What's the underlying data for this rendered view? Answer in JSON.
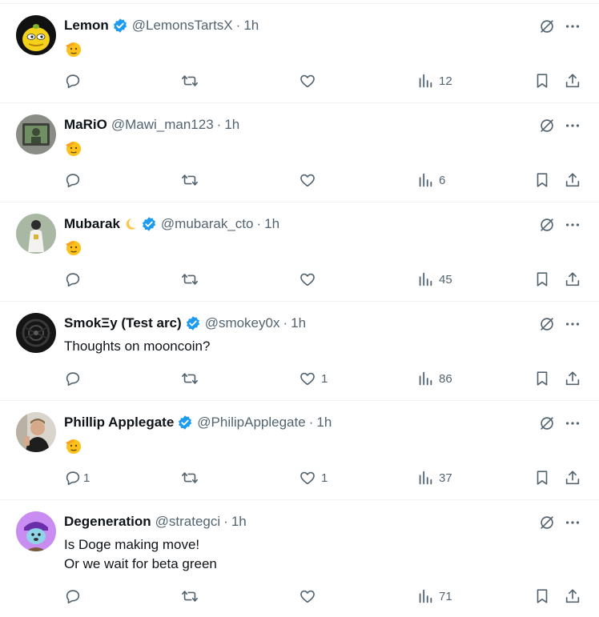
{
  "colors": {
    "text": "#0f1419",
    "muted": "#536471",
    "verified": "#1d9bf0",
    "divider": "#eff3f4"
  },
  "separator": "·",
  "tweets": [
    {
      "display_name": "Lemon",
      "verified": true,
      "handle": "@LemonsTartsX",
      "time": "1h",
      "text_lines": [],
      "emoji": "saluting-face",
      "replies": "",
      "likes": "",
      "views": "12",
      "avatar": "lemon-pepe"
    },
    {
      "display_name": "MaRiO",
      "verified": false,
      "handle": "@Mawi_man123",
      "time": "1h",
      "text_lines": [],
      "emoji": "saluting-face",
      "replies": "",
      "likes": "",
      "views": "6",
      "avatar": "monitor-portrait"
    },
    {
      "display_name": "Mubarak",
      "name_emoji": "crescent-moon",
      "verified": true,
      "handle": "@mubarak_cto",
      "time": "1h",
      "text_lines": [],
      "emoji": "saluting-face",
      "replies": "",
      "likes": "",
      "views": "45",
      "avatar": "white-robe-figure"
    },
    {
      "display_name": "SmokΞy (Test arc)",
      "verified": true,
      "handle": "@smokey0x",
      "time": "1h",
      "text_lines": [
        "Thoughts on mooncoin?"
      ],
      "emoji": "",
      "replies": "",
      "likes": "1",
      "views": "86",
      "avatar": "dark-pattern"
    },
    {
      "display_name": "Phillip Applegate",
      "verified": true,
      "handle": "@PhilipApplegate",
      "time": "1h",
      "text_lines": [],
      "emoji": "saluting-face",
      "replies": "1",
      "likes": "1",
      "views": "37",
      "avatar": "selfie-photo"
    },
    {
      "display_name": "Degeneration",
      "verified": false,
      "handle": "@strategci",
      "time": "1h",
      "text_lines": [
        "Is Doge making move!",
        "Or we wait for beta green"
      ],
      "emoji": "",
      "replies": "",
      "likes": "",
      "views": "71",
      "avatar": "purple-doge"
    }
  ]
}
